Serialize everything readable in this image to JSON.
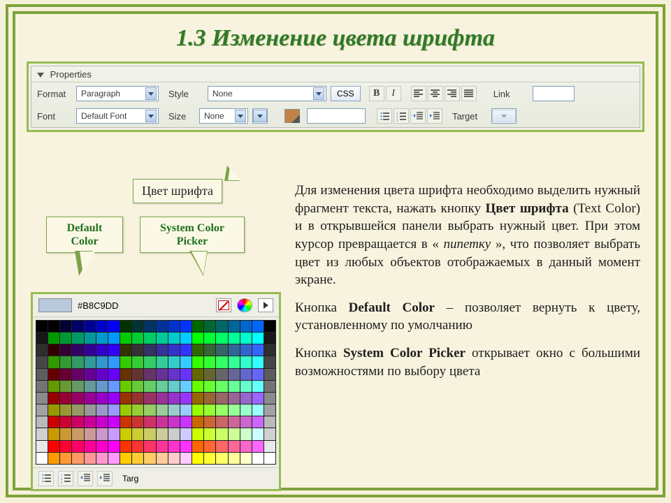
{
  "title": "1.3  Изменение цвета шрифта",
  "properties_panel": {
    "header": "Properties",
    "labels": {
      "format": "Format",
      "style": "Style",
      "font": "Font",
      "size": "Size",
      "link": "Link",
      "target": "Target"
    },
    "values": {
      "format": "Paragraph",
      "style": "None",
      "font": "Default Font",
      "size": "None"
    },
    "css_button": "CSS"
  },
  "callouts": {
    "font_color": "Цвет шрифта",
    "default_color_l1": "Default",
    "default_color_l2": "Color",
    "system_picker_l1": "System Color",
    "system_picker_l2": "Picker"
  },
  "color_picker": {
    "hex": "#B8C9DD",
    "footer_target": "Targ"
  },
  "body": {
    "p1a": "Для изменения цвета шрифта необходимо выделить нужный фрагмент текста, нажать кнопку ",
    "p1b": "Цвет шрифта",
    "p1c": " (Text Color) и в открывшейся панели выбрать нужный цвет. При этом курсор превращается в «",
    "p1d": "пипетку",
    "p1e": "», что позволяет выбрать цвет из любых объектов отображаемых в данный момент экране.",
    "p2a": "Кнопка ",
    "p2b": "Default Color",
    "p2c": " – позволяет вернуть к цвету, установленному по умолчанию",
    "p3a": "Кнопка ",
    "p3b": "System Color Picker",
    "p3c": " открывает окно с большими возможностями по выбору цвета"
  }
}
